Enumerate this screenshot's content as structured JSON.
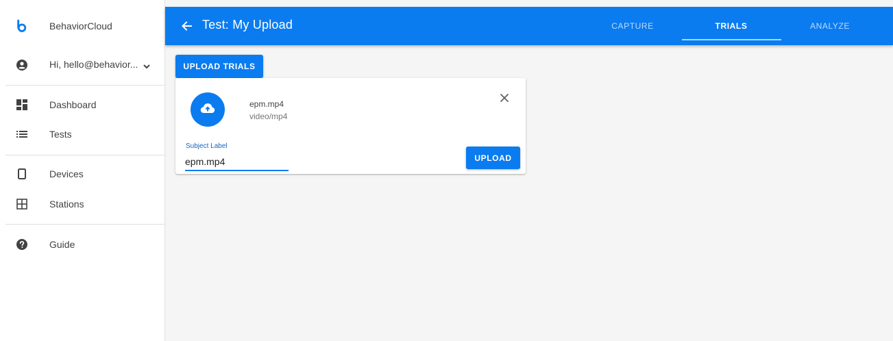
{
  "colors": {
    "primary": "#0a7cf0",
    "tab_indicator": "#9be3e8",
    "sidebar_bg": "#ffffff",
    "content_bg": "#f5f5f5"
  },
  "sidebar": {
    "brand": {
      "icon": "b-logo-icon",
      "label": "BehaviorCloud"
    },
    "account": {
      "icon": "account-circle-icon",
      "label": "Hi, hello@behavior...",
      "caret_icon": "chevron-down-icon"
    },
    "items": [
      {
        "icon": "dashboard-icon",
        "label": "Dashboard"
      },
      {
        "icon": "list-icon",
        "label": "Tests"
      },
      {
        "icon": "phone-icon",
        "label": "Devices"
      },
      {
        "icon": "grid-icon",
        "label": "Stations"
      },
      {
        "icon": "help-circle-icon",
        "label": "Guide"
      }
    ]
  },
  "appbar": {
    "back_icon": "arrow-back-icon",
    "title": "Test: My Upload",
    "tabs": [
      {
        "label": "CAPTURE",
        "active": false
      },
      {
        "label": "TRIALS",
        "active": true
      },
      {
        "label": "ANALYZE",
        "active": false
      }
    ]
  },
  "main": {
    "upload_trials_label": "UPLOAD TRIALS",
    "card": {
      "icon": "cloud-upload-icon",
      "file_name": "epm.mp4",
      "file_type": "video/mp4",
      "close_icon": "close-icon",
      "field_label": "Subject Label",
      "field_value": "epm.mp4",
      "upload_label": "UPLOAD"
    }
  }
}
